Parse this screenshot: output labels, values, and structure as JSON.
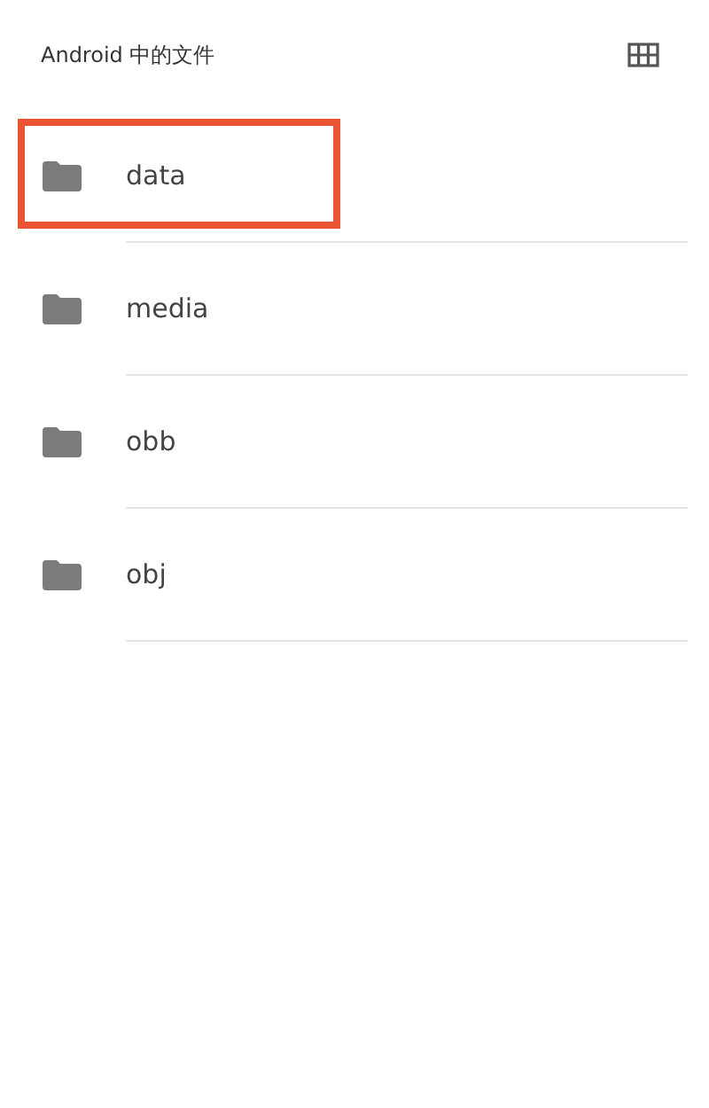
{
  "header": {
    "title": "Android 中的文件"
  },
  "folders": [
    {
      "name": "data",
      "highlighted": true
    },
    {
      "name": "media",
      "highlighted": false
    },
    {
      "name": "obb",
      "highlighted": false
    },
    {
      "name": "obj",
      "highlighted": false
    }
  ]
}
